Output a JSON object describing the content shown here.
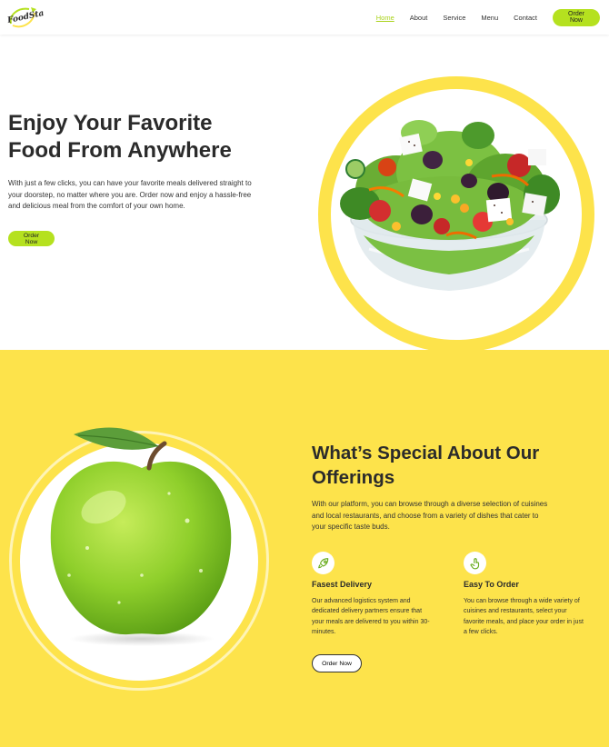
{
  "nav": {
    "logo_text": "FoodSta",
    "links": [
      {
        "label": "Home",
        "active": true
      },
      {
        "label": "About",
        "active": false
      },
      {
        "label": "Service",
        "active": false
      },
      {
        "label": "Menu",
        "active": false
      },
      {
        "label": "Contact",
        "active": false
      }
    ],
    "cta_label": "Order Now"
  },
  "hero": {
    "title_line1": "Enjoy Your Favorite",
    "title_line2": "Food From Anywhere",
    "description": "With just a few clicks, you can have your favorite meals delivered straight to your doorstep, no matter where you are. Order now and enjoy a hassle-free and delicious meal from the comfort of your own home.",
    "button_label": "Order Now",
    "image_name": "salad-bowl-image"
  },
  "special": {
    "title_line1": "What’s Special About Our",
    "title_line2": "Offerings",
    "description": "With our platform, you can browse through a diverse selection of cuisines and local restaurants, and choose from a variety of dishes that cater to your specific taste buds.",
    "features": [
      {
        "icon": "rocket-icon",
        "title": "Fasest Delivery",
        "description": "Our advanced logistics system and dedicated delivery partners ensure that your meals are delivered to you within 30-minutes."
      },
      {
        "icon": "tap-hand-icon",
        "title": "Easy To Order",
        "description": "You can browse through a wide variety of cuisines and restaurants, select your favorite meals, and place your order in just a few clicks."
      }
    ],
    "button_label": "Order Now",
    "image_name": "green-apple-image"
  },
  "colors": {
    "accent_green": "#b5e11f",
    "brand_yellow": "#fde34b",
    "text_dark": "#2b2b2b"
  }
}
